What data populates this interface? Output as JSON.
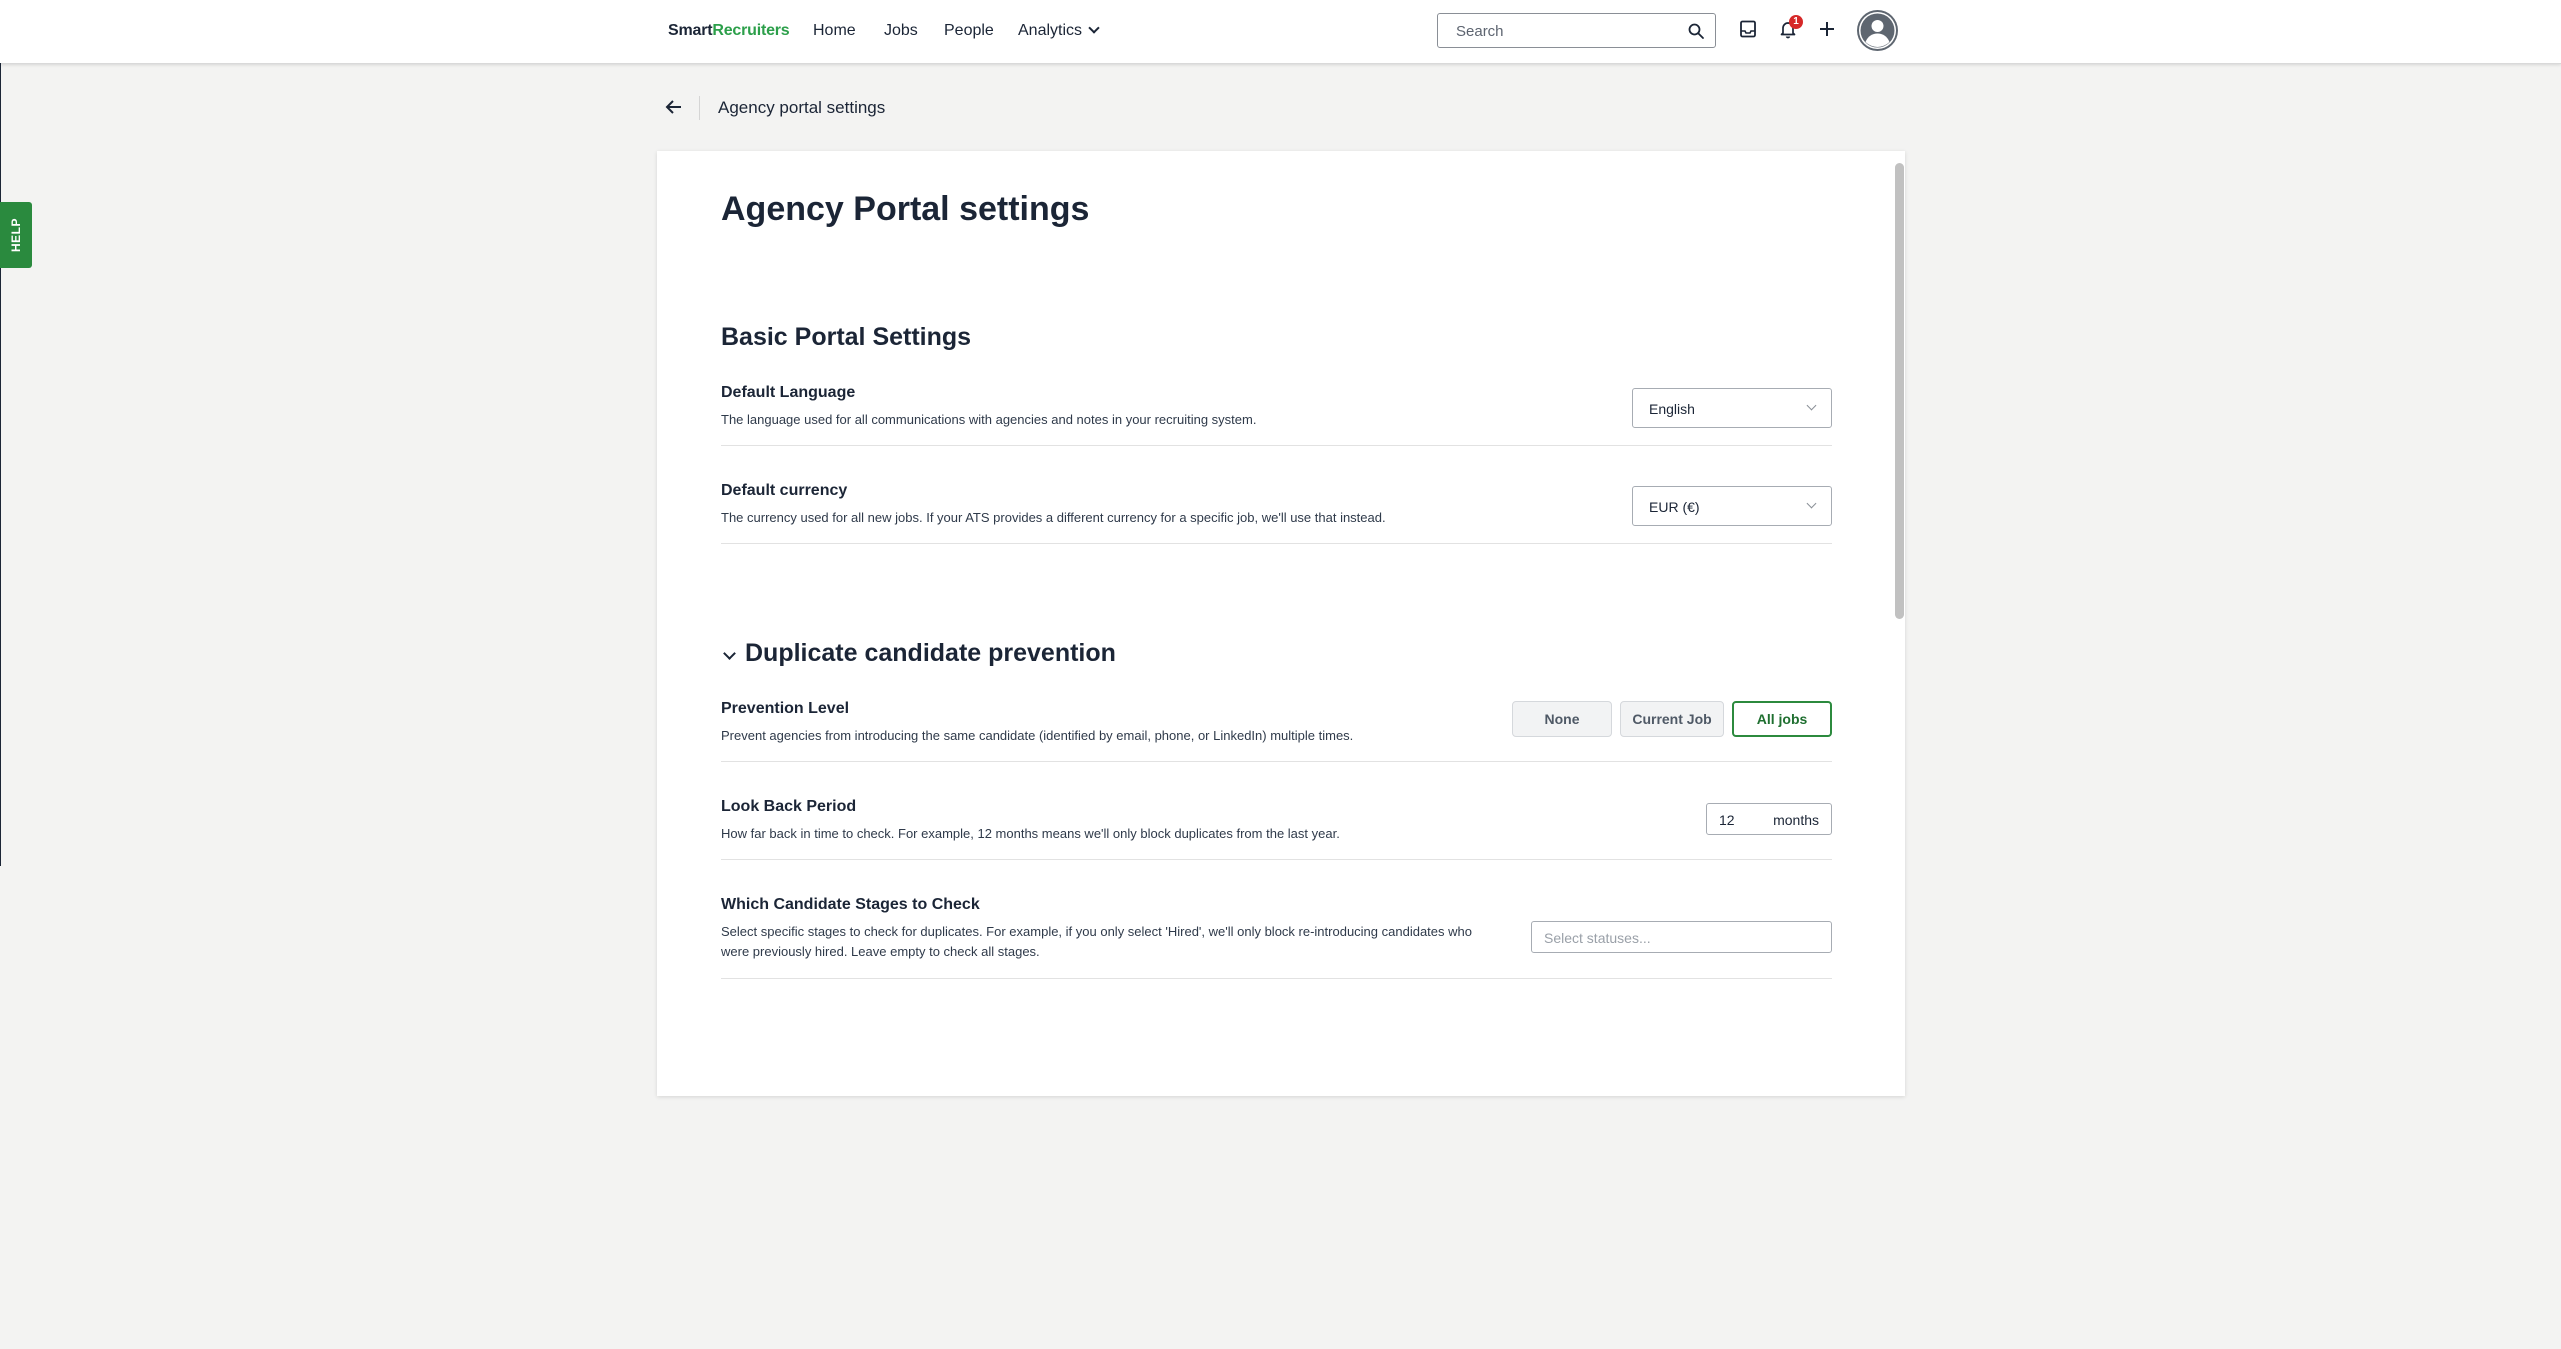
{
  "header": {
    "logo_part1": "Smart",
    "logo_part2": "Recruiters",
    "nav": [
      "Home",
      "Jobs",
      "People",
      "Analytics"
    ],
    "search_placeholder": "Search",
    "notification_count": "1",
    "accent_color": "#2c9f4a"
  },
  "help_label": "HELP",
  "breadcrumb": {
    "title": "Agency portal settings"
  },
  "page": {
    "title": "Agency Portal settings",
    "basic": {
      "heading": "Basic Portal Settings",
      "language": {
        "label": "Default Language",
        "desc": "The language used for all communications with agencies and notes in your recruiting system.",
        "value": "English"
      },
      "currency": {
        "label": "Default currency",
        "desc": "The currency used for all new jobs. If your ATS provides a different currency for a specific job, we'll use that instead.",
        "value": "EUR (€)"
      }
    },
    "duplicate": {
      "heading": "Duplicate candidate prevention",
      "prevention": {
        "label": "Prevention Level",
        "desc": "Prevent agencies from introducing the same candidate (identified by email, phone, or LinkedIn) multiple times.",
        "options": [
          "None",
          "Current Job",
          "All jobs"
        ],
        "selected": "All jobs"
      },
      "lookback": {
        "label": "Look Back Period",
        "desc": "How far back in time to check. For example, 12 months means we'll only block duplicates from the last year.",
        "value": "12",
        "unit": "months"
      },
      "stages": {
        "label": "Which Candidate Stages to Check",
        "desc": "Select specific stages to check for duplicates. For example, if you only select 'Hired', we'll only block re-introducing candidates who were previously hired. Leave empty to check all stages.",
        "placeholder": "Select statuses..."
      }
    }
  }
}
